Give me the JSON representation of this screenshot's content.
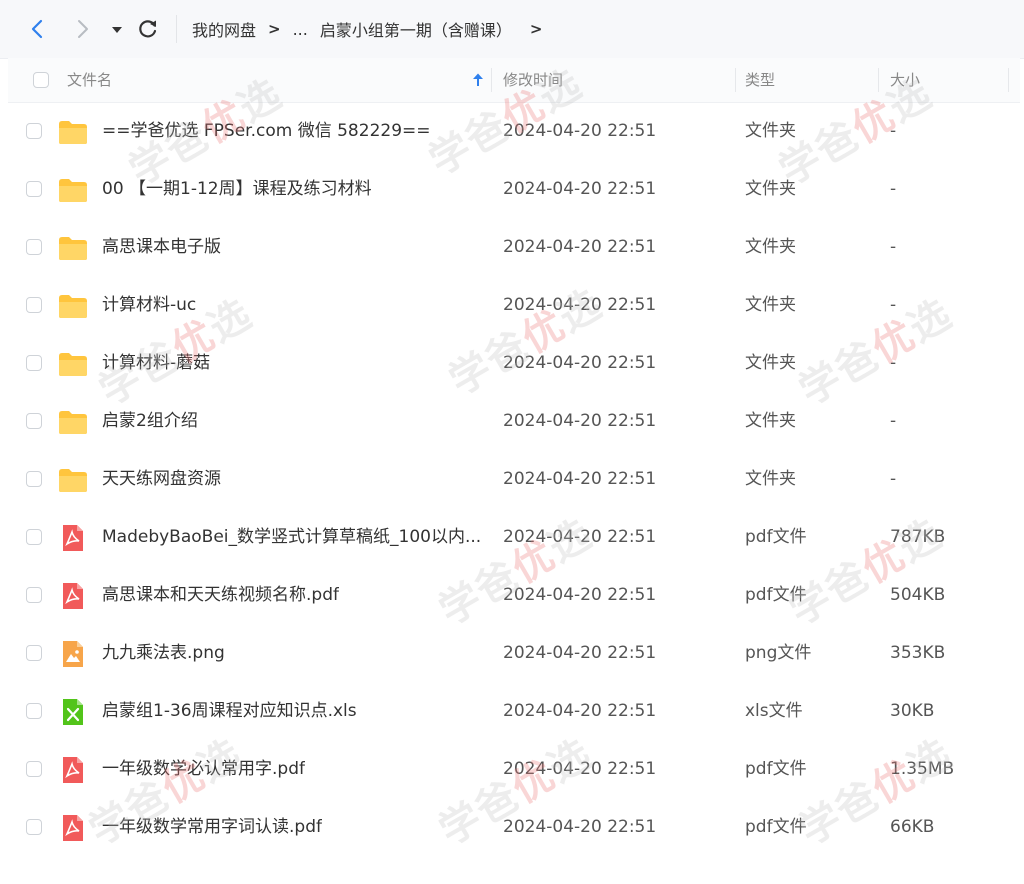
{
  "nav": {
    "back_icon": "chevron-left-icon",
    "forward_icon": "chevron-right-icon",
    "dropdown_icon": "caret-down-icon",
    "refresh_icon": "refresh-icon"
  },
  "breadcrumb": {
    "root": "我的网盘",
    "ellipsis": "...",
    "current": "启蒙小组第一期（含赠课）"
  },
  "table": {
    "headers": {
      "name": "文件名",
      "modified": "修改时间",
      "type": "类型",
      "size": "大小"
    },
    "sort_icon": "sort-ascending-icon",
    "rows": [
      {
        "icon": "folder-icon",
        "name": "==学爸优选 FPSer.com 微信 582229==",
        "modified": "2024-04-20 22:51",
        "type": "文件夹",
        "size": "-"
      },
      {
        "icon": "folder-icon",
        "name": "00 【一期1-12周】课程及练习材料",
        "modified": "2024-04-20 22:51",
        "type": "文件夹",
        "size": "-"
      },
      {
        "icon": "folder-icon",
        "name": "高思课本电子版",
        "modified": "2024-04-20 22:51",
        "type": "文件夹",
        "size": "-"
      },
      {
        "icon": "folder-icon",
        "name": "计算材料-uc",
        "modified": "2024-04-20 22:51",
        "type": "文件夹",
        "size": "-"
      },
      {
        "icon": "folder-icon",
        "name": "计算材料-蘑菇",
        "modified": "2024-04-20 22:51",
        "type": "文件夹",
        "size": "-"
      },
      {
        "icon": "folder-icon",
        "name": "启蒙2组介绍",
        "modified": "2024-04-20 22:51",
        "type": "文件夹",
        "size": "-"
      },
      {
        "icon": "folder-icon",
        "name": "天天练网盘资源",
        "modified": "2024-04-20 22:51",
        "type": "文件夹",
        "size": "-"
      },
      {
        "icon": "pdf-icon",
        "name": "MadebyBaoBei_数学竖式计算草稿纸_100以内...",
        "modified": "2024-04-20 22:51",
        "type": "pdf文件",
        "size": "787KB"
      },
      {
        "icon": "pdf-icon",
        "name": "高思课本和天天练视频名称.pdf",
        "modified": "2024-04-20 22:51",
        "type": "pdf文件",
        "size": "504KB"
      },
      {
        "icon": "image-icon",
        "name": "九九乘法表.png",
        "modified": "2024-04-20 22:51",
        "type": "png文件",
        "size": "353KB"
      },
      {
        "icon": "excel-icon",
        "name": "启蒙组1-36周课程对应知识点.xls",
        "modified": "2024-04-20 22:51",
        "type": "xls文件",
        "size": "30KB"
      },
      {
        "icon": "pdf-icon",
        "name": "一年级数学必认常用字.pdf",
        "modified": "2024-04-20 22:51",
        "type": "pdf文件",
        "size": "1.35MB"
      },
      {
        "icon": "pdf-icon",
        "name": "一年级数学常用字词认读.pdf",
        "modified": "2024-04-20 22:51",
        "type": "pdf文件",
        "size": "66KB"
      }
    ]
  },
  "colors": {
    "accent": "#2f80ed",
    "folder": "#ffc53d",
    "pdf": "#f15a5a",
    "image": "#f7a54a",
    "excel": "#52c41a"
  }
}
